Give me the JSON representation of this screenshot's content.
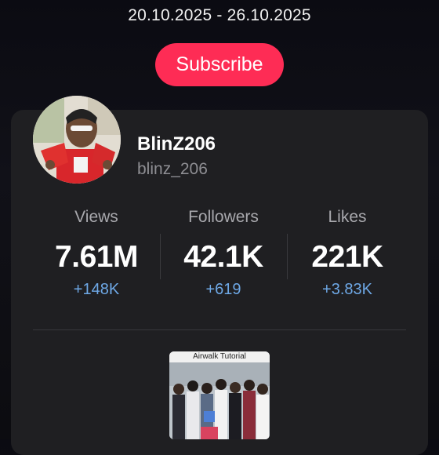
{
  "header": {
    "date_range": "20.10.2025 - 26.10.2025",
    "subscribe_label": "Subscribe"
  },
  "profile": {
    "display_name": "BlinZ206",
    "username": "blinz_206"
  },
  "stats": [
    {
      "label": "Views",
      "value": "7.61M",
      "delta": "+148K"
    },
    {
      "label": "Followers",
      "value": "42.1K",
      "delta": "+619"
    },
    {
      "label": "Likes",
      "value": "221K",
      "delta": "+3.83K"
    }
  ],
  "video": {
    "title": "Airwalk Tutorial"
  },
  "colors": {
    "accent": "#fe2c55",
    "delta": "#6ea8e6",
    "card": "#1f1f22"
  }
}
